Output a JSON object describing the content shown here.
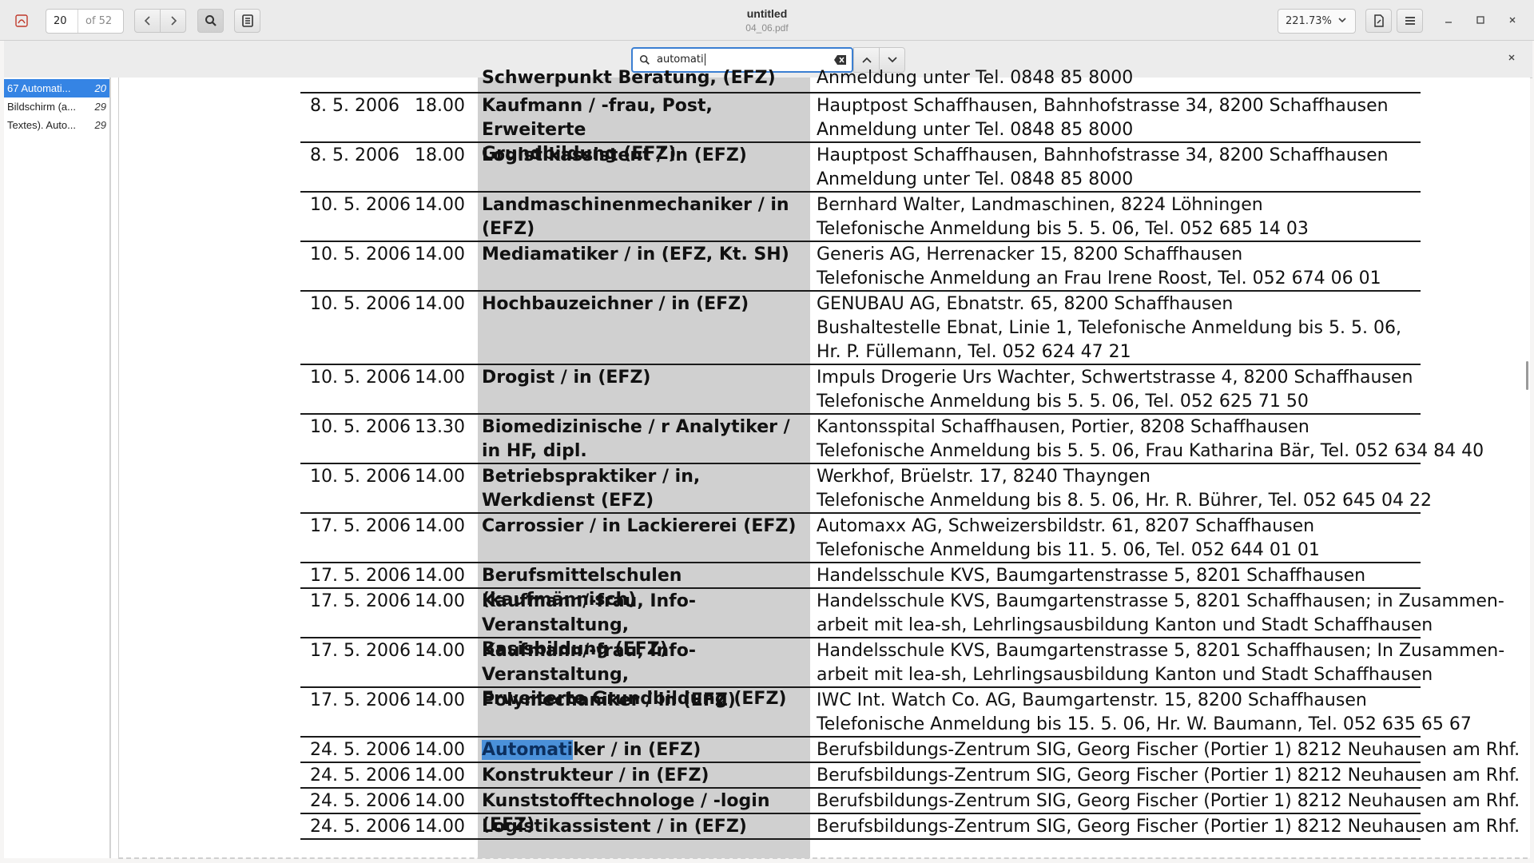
{
  "header": {
    "page_current": "20",
    "page_total": "of 52",
    "title": "untitled",
    "subtitle": "04_06.pdf",
    "zoom": "221.73%"
  },
  "find": {
    "query": "automati"
  },
  "sidebar": {
    "results": [
      {
        "text": "67 Automati...",
        "page": "20",
        "selected": true
      },
      {
        "text": "Bildschirm (a...",
        "page": "29",
        "selected": false
      },
      {
        "text": "Textes). Auto...",
        "page": "29",
        "selected": false
      }
    ]
  },
  "document": {
    "partial_top": {
      "job": "Schwerpunkt Beratung, (EFZ)",
      "loc": "Anmeldung unter Tel. 0848 85 8000"
    },
    "rows": [
      {
        "date": "8. 5. 2006",
        "time": "18.00",
        "job": [
          "Kaufmann / -frau, Post, Erweiterte",
          "Grundbildung (EFZ)"
        ],
        "loc": [
          "Hauptpost Schaffhausen, Bahnhofstrasse 34, 8200 Schaffhausen",
          "Anmeldung unter Tel. 0848 85 8000"
        ]
      },
      {
        "date": "8. 5. 2006",
        "time": "18.00",
        "job": [
          "Logistikassistent / in (EFZ)"
        ],
        "loc": [
          "Hauptpost Schaffhausen, Bahnhofstrasse 34, 8200 Schaffhausen",
          "Anmeldung unter Tel. 0848 85 8000"
        ]
      },
      {
        "date": "10. 5. 2006",
        "time": "14.00",
        "job": [
          "Landmaschinenmechaniker / in (EFZ)"
        ],
        "loc": [
          "Bernhard Walter, Landmaschinen, 8224 Löhningen",
          "Telefonische Anmeldung bis 5. 5. 06, Tel. 052 685 14 03"
        ]
      },
      {
        "date": "10. 5. 2006",
        "time": "14.00",
        "job": [
          "Mediamatiker / in (EFZ, Kt. SH)"
        ],
        "loc": [
          "Generis AG, Herrenacker 15, 8200 Schaffhausen",
          "Telefonische Anmeldung an Frau Irene Roost, Tel. 052 674 06 01"
        ]
      },
      {
        "date": "10. 5. 2006",
        "time": "14.00",
        "job": [
          "Hochbauzeichner / in (EFZ)"
        ],
        "loc": [
          "GENUBAU AG, Ebnatstr. 65, 8200 Schaffhausen",
          "Bushaltestelle Ebnat, Linie 1, Telefonische Anmeldung bis 5. 5. 06,",
          "Hr. P. Füllemann, Tel. 052 624 47 21"
        ]
      },
      {
        "date": "10. 5. 2006",
        "time": "14.00",
        "job": [
          "Drogist / in (EFZ)"
        ],
        "loc": [
          "Impuls Drogerie Urs Wachter, Schwertstrasse 4, 8200 Schaffhausen",
          "Telefonische Anmeldung bis 5. 5. 06, Tel. 052 625 71 50"
        ]
      },
      {
        "date": "10. 5. 2006",
        "time": "13.30",
        "job": [
          "Biomedizinische / r Analytiker / in HF, dipl."
        ],
        "loc": [
          "Kantonsspital Schaffhausen, Portier, 8208 Schaffhausen",
          "Telefonische Anmeldung bis 5. 5. 06, Frau Katharina Bär, Tel. 052 634 84 40"
        ]
      },
      {
        "date": "10. 5. 2006",
        "time": "14.00",
        "job": [
          "Betriebspraktiker / in, Werkdienst (EFZ)"
        ],
        "loc": [
          "Werkhof, Brüelstr. 17, 8240 Thayngen",
          "Telefonische Anmeldung bis 8. 5. 06, Hr. R. Bührer, Tel. 052 645 04 22"
        ]
      },
      {
        "date": "17. 5. 2006",
        "time": "14.00",
        "job": [
          "Carrossier / in Lackiererei (EFZ)"
        ],
        "loc": [
          "Automaxx AG, Schweizersbildstr. 61, 8207 Schaffhausen",
          "Telefonische Anmeldung bis 11. 5. 06, Tel. 052 644 01 01"
        ]
      },
      {
        "date": "17. 5. 2006",
        "time": "14.00",
        "job": [
          "Berufsmittelschulen (kaufmännisch)"
        ],
        "loc": [
          "Handelsschule KVS, Baumgartenstrasse 5, 8201 Schaffhausen"
        ]
      },
      {
        "date": "17. 5. 2006",
        "time": "14.00",
        "job": [
          "Kaufmann/-frau, Info-Veranstaltung,",
          "Basisbildung (EFZ)"
        ],
        "loc": [
          "Handelsschule KVS, Baumgartenstrasse 5, 8201 Schaffhausen; in Zusammen-",
          "arbeit mit lea-sh, Lehrlingsausbildung Kanton und Stadt Schaffhausen"
        ]
      },
      {
        "date": "17. 5. 2006",
        "time": "14.00",
        "job": [
          "Kaufmann/-frau, Info-Veranstaltung,",
          "Erweiterte Grundbildung (EFZ)"
        ],
        "loc": [
          "Handelsschule KVS, Baumgartenstrasse 5, 8201 Schaffhausen; In Zusammen-",
          "arbeit mit lea-sh, Lehrlingsausbildung Kanton und Stadt Schaffhausen"
        ]
      },
      {
        "date": "17. 5. 2006",
        "time": "14.00",
        "job": [
          "Polymechaniker / in (EFZ)"
        ],
        "loc": [
          "IWC Int. Watch Co. AG, Baumgartenstr. 15, 8200 Schaffhausen",
          "Telefonische Anmeldung bis 15. 5. 06, Hr. W. Baumann, Tel. 052 635 65 67"
        ]
      },
      {
        "date": "24. 5. 2006",
        "time": "14.00",
        "job_hl": "Automati",
        "job_rest": "ker / in (EFZ)",
        "loc": [
          "Berufsbildungs-Zentrum SIG, Georg Fischer (Portier 1) 8212 Neuhausen am Rhf."
        ]
      },
      {
        "date": "24. 5. 2006",
        "time": "14.00",
        "job": [
          "Konstrukteur / in (EFZ)"
        ],
        "loc": [
          "Berufsbildungs-Zentrum SIG, Georg Fischer (Portier 1) 8212 Neuhausen am Rhf."
        ]
      },
      {
        "date": "24. 5. 2006",
        "time": "14.00",
        "job": [
          "Kunststofftechnologe / -login (EFZ)"
        ],
        "loc": [
          "Berufsbildungs-Zentrum SIG, Georg Fischer (Portier 1) 8212 Neuhausen am Rhf."
        ]
      },
      {
        "date": "24. 5. 2006",
        "time": "14.00",
        "job": [
          "Logistikassistent / in (EFZ)"
        ],
        "loc": [
          "Berufsbildungs-Zentrum SIG, Georg Fischer (Portier 1) 8212 Neuhausen am Rhf."
        ]
      }
    ]
  }
}
